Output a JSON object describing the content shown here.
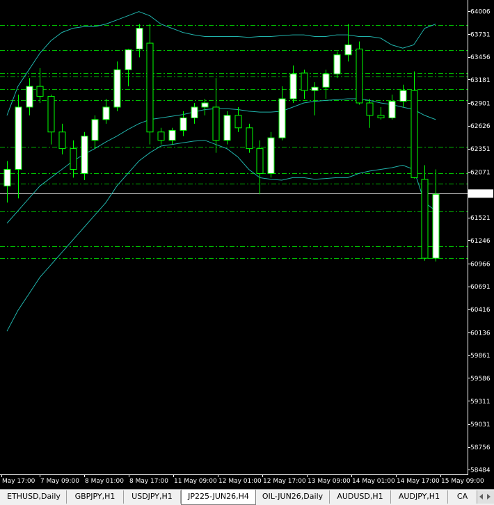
{
  "chart_data": {
    "type": "candlestick",
    "symbol": "JP225-JUN26",
    "timeframe": "H4",
    "y_axis": {
      "min": 58484,
      "max": 64006,
      "ticks": [
        "64006",
        "63731",
        "63456",
        "63181",
        "62901",
        "62626",
        "62351",
        "62071",
        "61808",
        "61521",
        "61246",
        "60966",
        "60691",
        "60416",
        "60136",
        "59861",
        "59586",
        "59311",
        "59031",
        "58756",
        "58484"
      ],
      "current_price": 61808
    },
    "x_axis_labels": [
      "May 17:00",
      "7 May 09:00",
      "8 May 01:00",
      "8 May 17:00",
      "11 May 09:00",
      "12 May 01:00",
      "12 May 17:00",
      "13 May 09:00",
      "14 May 01:00",
      "14 May 17:00",
      "15 May 09:00"
    ],
    "horizontal_levels": [
      63840,
      63540,
      63260,
      63220,
      63070,
      62930,
      62370,
      62050,
      61930,
      61590,
      61170,
      61030
    ],
    "candles": [
      {
        "o": 61900,
        "h": 62200,
        "l": 61700,
        "c": 62100
      },
      {
        "o": 62100,
        "h": 63000,
        "l": 61750,
        "c": 62850
      },
      {
        "o": 62850,
        "h": 63200,
        "l": 62750,
        "c": 63100
      },
      {
        "o": 63100,
        "h": 63320,
        "l": 62900,
        "c": 62980
      },
      {
        "o": 62980,
        "h": 63000,
        "l": 62400,
        "c": 62550
      },
      {
        "o": 62550,
        "h": 62650,
        "l": 62280,
        "c": 62350
      },
      {
        "o": 62350,
        "h": 62450,
        "l": 62000,
        "c": 62100
      },
      {
        "o": 62050,
        "h": 62550,
        "l": 61970,
        "c": 62500
      },
      {
        "o": 62450,
        "h": 62750,
        "l": 62350,
        "c": 62700
      },
      {
        "o": 62700,
        "h": 62950,
        "l": 62650,
        "c": 62850
      },
      {
        "o": 62850,
        "h": 63400,
        "l": 62800,
        "c": 63300
      },
      {
        "o": 63300,
        "h": 63550,
        "l": 63100,
        "c": 63540
      },
      {
        "o": 63550,
        "h": 63850,
        "l": 63450,
        "c": 63800
      },
      {
        "o": 63620,
        "h": 63850,
        "l": 62400,
        "c": 62550
      },
      {
        "o": 62550,
        "h": 62600,
        "l": 62400,
        "c": 62450
      },
      {
        "o": 62450,
        "h": 62600,
        "l": 62400,
        "c": 62570
      },
      {
        "o": 62570,
        "h": 62800,
        "l": 62500,
        "c": 62720
      },
      {
        "o": 62720,
        "h": 62900,
        "l": 62650,
        "c": 62850
      },
      {
        "o": 62850,
        "h": 62950,
        "l": 62750,
        "c": 62900
      },
      {
        "o": 62850,
        "h": 63200,
        "l": 62300,
        "c": 62450
      },
      {
        "o": 62450,
        "h": 62800,
        "l": 62400,
        "c": 62750
      },
      {
        "o": 62750,
        "h": 62850,
        "l": 62550,
        "c": 62600
      },
      {
        "o": 62600,
        "h": 62650,
        "l": 62300,
        "c": 62350
      },
      {
        "o": 62350,
        "h": 62450,
        "l": 61800,
        "c": 62050
      },
      {
        "o": 62050,
        "h": 62550,
        "l": 62000,
        "c": 62480
      },
      {
        "o": 62480,
        "h": 63100,
        "l": 62450,
        "c": 62950
      },
      {
        "o": 62950,
        "h": 63350,
        "l": 62900,
        "c": 63250
      },
      {
        "o": 63260,
        "h": 63300,
        "l": 62950,
        "c": 63050
      },
      {
        "o": 63050,
        "h": 63150,
        "l": 62750,
        "c": 63090
      },
      {
        "o": 63090,
        "h": 63300,
        "l": 62950,
        "c": 63250
      },
      {
        "o": 63250,
        "h": 63520,
        "l": 63200,
        "c": 63480
      },
      {
        "o": 63480,
        "h": 63850,
        "l": 63400,
        "c": 63600
      },
      {
        "o": 63550,
        "h": 63640,
        "l": 62880,
        "c": 62900
      },
      {
        "o": 62900,
        "h": 62950,
        "l": 62600,
        "c": 62750
      },
      {
        "o": 62750,
        "h": 62850,
        "l": 62700,
        "c": 62720
      },
      {
        "o": 62720,
        "h": 63000,
        "l": 62700,
        "c": 62920
      },
      {
        "o": 62920,
        "h": 63120,
        "l": 62850,
        "c": 63050
      },
      {
        "o": 63050,
        "h": 63280,
        "l": 61990,
        "c": 62000
      },
      {
        "o": 61980,
        "h": 62150,
        "l": 61000,
        "c": 61030
      },
      {
        "o": 61030,
        "h": 62100,
        "l": 60990,
        "c": 61800
      }
    ],
    "bollinger": {
      "upper": [
        62750,
        63100,
        63300,
        63500,
        63650,
        63750,
        63800,
        63820,
        63820,
        63850,
        63900,
        63950,
        64000,
        63950,
        63850,
        63800,
        63750,
        63720,
        63700,
        63700,
        63700,
        63700,
        63690,
        63700,
        63700,
        63710,
        63720,
        63720,
        63700,
        63700,
        63720,
        63720,
        63700,
        63700,
        63680,
        63600,
        63560,
        63600,
        63800,
        63850
      ],
      "middle": [
        61450,
        61600,
        61750,
        61900,
        62000,
        62100,
        62200,
        62280,
        62350,
        62430,
        62500,
        62580,
        62650,
        62700,
        62720,
        62740,
        62760,
        62790,
        62820,
        62830,
        62830,
        62820,
        62800,
        62790,
        62790,
        62800,
        62850,
        62900,
        62920,
        62930,
        62940,
        62950,
        62950,
        62930,
        62900,
        62880,
        62850,
        62820,
        62750,
        62700
      ],
      "lower": [
        60150,
        60400,
        60600,
        60800,
        60950,
        61100,
        61250,
        61400,
        61550,
        61700,
        61900,
        62050,
        62200,
        62300,
        62380,
        62400,
        62420,
        62440,
        62450,
        62400,
        62350,
        62250,
        62100,
        62000,
        61980,
        61970,
        62000,
        62000,
        61980,
        61990,
        62000,
        62000,
        62050,
        62080,
        62100,
        62120,
        62150,
        62100,
        61700,
        61600
      ]
    },
    "colors": {
      "background": "#000000",
      "bull_body": "#ffffff",
      "bear_body": "#000000",
      "wick": "#00ff00",
      "bands": "#20b2aa",
      "levels": "#00c000",
      "current_line": "#c0c0c0"
    }
  },
  "tabs": [
    {
      "label": "ETHUSD,Daily"
    },
    {
      "label": "GBPJPY,H1"
    },
    {
      "label": "USDJPY,H1"
    },
    {
      "label": "JP225-JUN26,H4"
    },
    {
      "label": "OIL-JUN26,Daily"
    },
    {
      "label": "AUDUSD,H1"
    },
    {
      "label": "AUDJPY,H1"
    },
    {
      "label": "CA"
    }
  ],
  "active_tab_index": 3
}
